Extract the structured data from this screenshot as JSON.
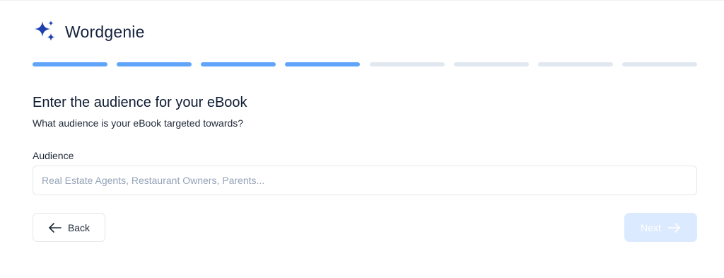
{
  "brand": {
    "name": "Wordgenie",
    "icon": "sparkles-icon",
    "color": "#1e40af"
  },
  "progress": {
    "total_steps": 8,
    "completed_steps": 4,
    "active_color": "#60a5fa",
    "inactive_color": "#e2e8f0"
  },
  "form": {
    "title": "Enter the audience for your eBook",
    "subtitle": "What audience is your eBook targeted towards?",
    "audience_label": "Audience",
    "audience_placeholder": "Real Estate Agents, Restaurant Owners, Parents...",
    "audience_value": ""
  },
  "buttons": {
    "back_label": "Back",
    "back_icon": "arrow-left-icon",
    "next_label": "Next",
    "next_icon": "arrow-right-icon",
    "next_enabled": false
  }
}
